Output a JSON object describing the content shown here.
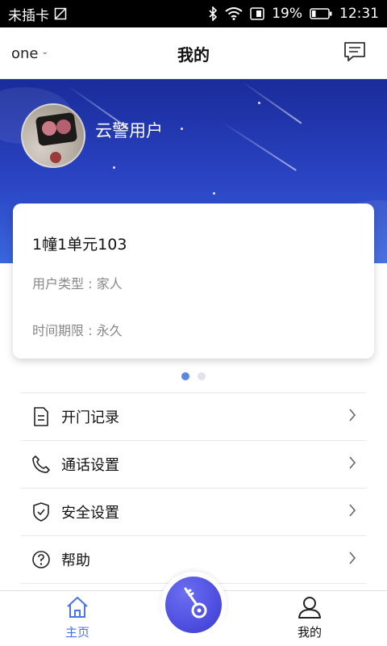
{
  "status_bar": {
    "carrier": "未插卡",
    "battery": "19%",
    "time": "12:31"
  },
  "header": {
    "community": "one",
    "title": "我的"
  },
  "profile": {
    "username": "云警用户"
  },
  "unit_card": {
    "unit": "1幢1单元103",
    "user_type": "用户类型 : 家人",
    "time_limit": "时间期限 : 永久"
  },
  "pager": {
    "count": 2,
    "active_index": 0
  },
  "menu": {
    "items": [
      {
        "label": "开门记录",
        "icon": "document-icon"
      },
      {
        "label": "通话设置",
        "icon": "phone-icon"
      },
      {
        "label": "安全设置",
        "icon": "shield-icon"
      },
      {
        "label": "帮助",
        "icon": "help-icon"
      }
    ]
  },
  "tabbar": {
    "home_label": "主页",
    "mine_label": "我的",
    "center_icon": "key-icon",
    "active_color": "#4a74e0"
  },
  "colors": {
    "banner_top": "#1a2b9a",
    "banner_bottom": "#3a66dd",
    "fab": "#4f4fe0"
  }
}
